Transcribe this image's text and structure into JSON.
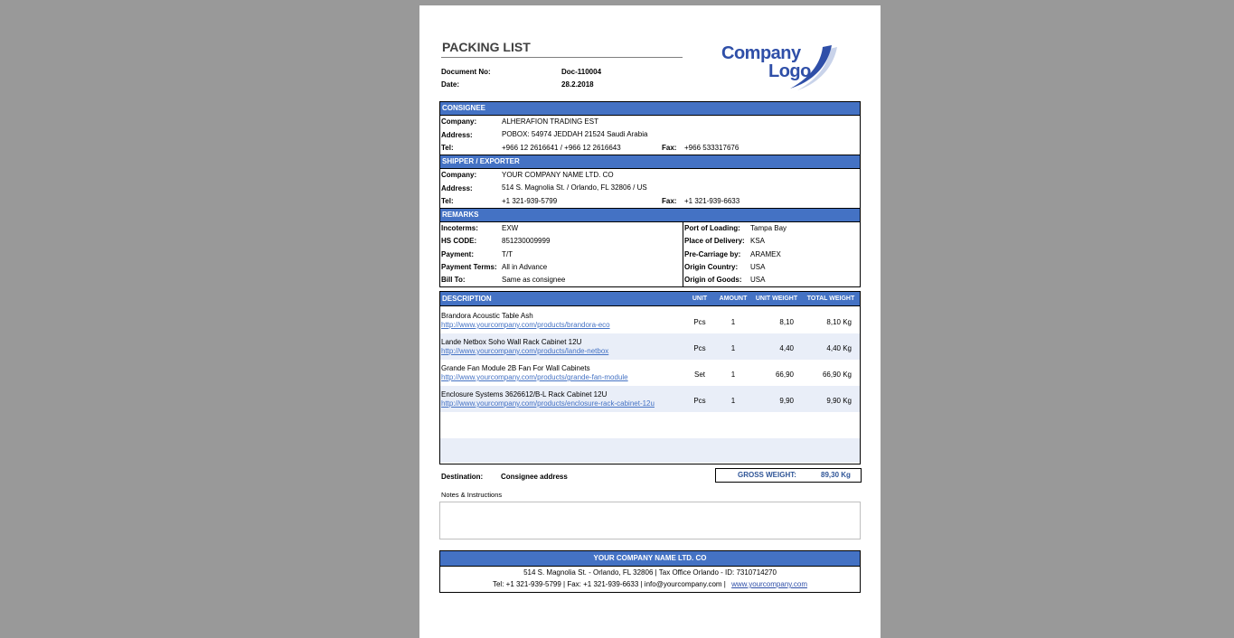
{
  "document": {
    "title": "PACKING LIST",
    "doc_no_label": "Document No:",
    "doc_no": "Doc-110004",
    "date_label": "Date:",
    "date": "28.2.2018",
    "logo_line1": "Company",
    "logo_line2": "Logo"
  },
  "consignee": {
    "header": "CONSIGNEE",
    "company_label": "Company:",
    "company": "ALHERAFION TRADING EST",
    "address_label": "Address:",
    "address": "POBOX: 54974 JEDDAH 21524 Saudi Arabia",
    "tel_label": "Tel:",
    "tel": "+966 12 2616641 / +966 12 2616643",
    "fax_label": "Fax:",
    "fax": "+966 533317676"
  },
  "shipper": {
    "header": "SHIPPER / EXPORTER",
    "company_label": "Company:",
    "company": "YOUR COMPANY NAME LTD. CO",
    "address_label": "Address:",
    "address": "514 S. Magnolia St. / Orlando, FL 32806 / US",
    "tel_label": "Tel:",
    "tel": "+1 321-939-5799",
    "fax_label": "Fax:",
    "fax": "+1 321-939-6633"
  },
  "remarks": {
    "header": "REMARKS",
    "left": [
      {
        "label": "Incoterms:",
        "value": "EXW"
      },
      {
        "label": "HS CODE:",
        "value": "851230009999"
      },
      {
        "label": "Payment:",
        "value": "T/T"
      },
      {
        "label": "Payment Terms:",
        "value": "All in Advance"
      },
      {
        "label": "Bill To:",
        "value": "Same as consignee"
      }
    ],
    "right": [
      {
        "label": "Port of Loading:",
        "value": "Tampa Bay"
      },
      {
        "label": "Place of Delivery:",
        "value": "KSA"
      },
      {
        "label": "Pre-Carriage by:",
        "value": "ARAMEX"
      },
      {
        "label": "Origin Country:",
        "value": "USA"
      },
      {
        "label": "Origin of Goods:",
        "value": "USA"
      }
    ]
  },
  "items": {
    "headers": {
      "description": "DESCRIPTION",
      "unit": "UNIT",
      "amount": "AMOUNT",
      "unit_weight": "UNIT WEIGHT",
      "total_weight": "TOTAL WEIGHT"
    },
    "rows": [
      {
        "name": "Brandora Acoustic Table Ash",
        "link": "http://www.yourcompany.com/products/brandora-eco",
        "unit": "Pcs",
        "amount": "1",
        "unit_weight": "8,10",
        "total_weight": "8,10 Kg"
      },
      {
        "name": "Lande Netbox Soho Wall Rack Cabinet 12U",
        "link": "http://www.yourcompany.com/products/lande-netbox",
        "unit": "Pcs",
        "amount": "1",
        "unit_weight": "4,40",
        "total_weight": "4,40 Kg"
      },
      {
        "name": "Grande Fan Module 2B Fan For Wall Cabinets",
        "link": "http://www.yourcompany.com/products/grande-fan-module",
        "unit": "Set",
        "amount": "1",
        "unit_weight": "66,90",
        "total_weight": "66,90 Kg"
      },
      {
        "name": "Enclosure Systems 3626612/B-L Rack Cabinet 12U",
        "link": "http://www.yourcompany.com/products/enclosure-rack-cabinet-12u",
        "unit": "Pcs",
        "amount": "1",
        "unit_weight": "9,90",
        "total_weight": "9,90 Kg"
      }
    ]
  },
  "summary": {
    "destination_label": "Destination:",
    "destination": "Consignee address",
    "gross_label": "GROSS WEIGHT:",
    "gross_value": "89,30 Kg",
    "notes_label": "Notes & Instructions"
  },
  "footer": {
    "company": "YOUR COMPANY NAME LTD. CO",
    "line1": "514 S. Magnolia St. - Orlando, FL 32806  |  Tax Office Orlando - ID: 7310714270",
    "line2_prefix": "Tel: +1 321-939-5799   |   Fax: +1 321-939-6633   |   info@yourcompany.com   |",
    "website": "www.yourcompany.com"
  },
  "colors": {
    "accent": "#4472c4",
    "background": "#999999",
    "alt_row": "#e9eef8"
  }
}
